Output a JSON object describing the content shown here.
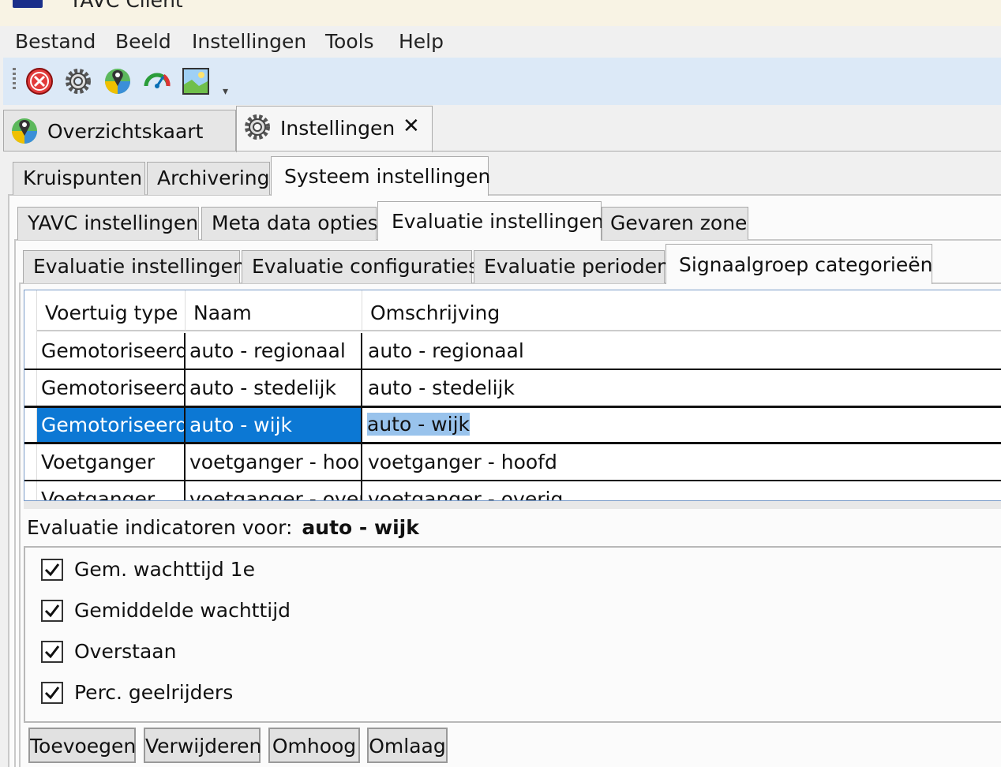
{
  "window": {
    "title": "YAVC Client"
  },
  "menu": {
    "items": [
      "Bestand",
      "Beeld",
      "Instellingen",
      "Tools",
      "Help"
    ]
  },
  "toolbar": {
    "icons": [
      "close-circle-icon",
      "gear-icon",
      "map-pin-icon",
      "speedometer-icon",
      "image-icon"
    ]
  },
  "doc_tabs": [
    {
      "label": "Overzichtskaart",
      "icon": "map-pin-icon"
    },
    {
      "label": "Instellingen",
      "icon": "gear-icon",
      "close": "✕"
    }
  ],
  "settings_tabs": [
    "Kruispunten",
    "Archivering",
    "Systeem instellingen"
  ],
  "system_tabs": [
    "YAVC instellingen",
    "Meta data opties",
    "Evaluatie instellingen",
    "Gevaren zone"
  ],
  "evaluation_tabs": [
    "Evaluatie instellingen",
    "Evaluatie configuraties",
    "Evaluatie perioden",
    "Signaalgroep categorieën"
  ],
  "grid": {
    "columns": [
      "Voertuig type",
      "Naam",
      "Omschrijving"
    ],
    "rows": [
      {
        "type": "Gemotoriseerd",
        "naam": "auto - regionaal",
        "omschrijving": "auto - regionaal"
      },
      {
        "type": "Gemotoriseerd",
        "naam": "auto - stedelijk",
        "omschrijving": "auto - stedelijk"
      },
      {
        "type": "Gemotoriseerd",
        "naam": "auto - wijk",
        "omschrijving": "auto - wijk"
      },
      {
        "type": "Voetganger",
        "naam": "voetganger - hoo",
        "omschrijving": "voetganger - hoofd"
      },
      {
        "type": "Voetganger",
        "naam": "voetganger - overig",
        "omschrijving": "voetganger - overig"
      }
    ]
  },
  "indicators": {
    "label": "Evaluatie indicatoren voor:",
    "selected": "auto - wijk",
    "items": [
      {
        "label": "Gem. wachttijd 1e",
        "checked": true
      },
      {
        "label": "Gemiddelde wachttijd",
        "checked": true
      },
      {
        "label": "Overstaan",
        "checked": true
      },
      {
        "label": "Perc. geelrijders",
        "checked": true
      }
    ]
  },
  "buttons": [
    "Toevoegen",
    "Verwijderen",
    "Omhoog",
    "Omlaag"
  ],
  "colors": {
    "selection": "#0c78d4",
    "toolbar": "#dce9f7",
    "titlebar": "#f8f3e4"
  }
}
